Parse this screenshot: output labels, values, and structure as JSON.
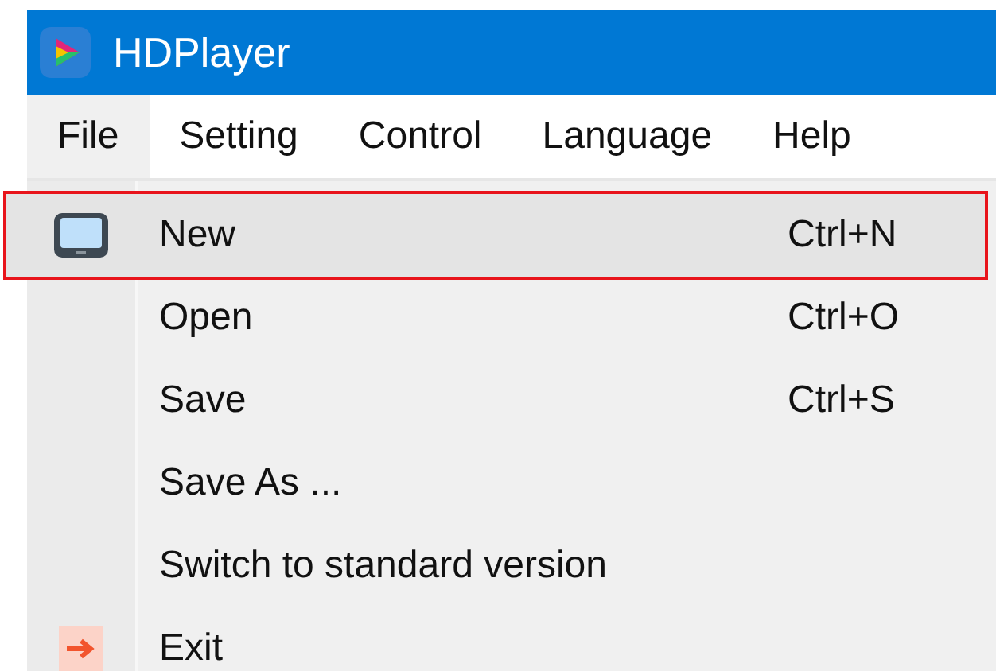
{
  "window": {
    "title": "HDPlayer"
  },
  "menu_bar": [
    {
      "label": "File",
      "selected": true
    },
    {
      "label": "Setting",
      "selected": false
    },
    {
      "label": "Control",
      "selected": false
    },
    {
      "label": "Language",
      "selected": false
    },
    {
      "label": "Help",
      "selected": false
    }
  ],
  "dropdown": [
    {
      "label": "New",
      "shortcut": "Ctrl+N",
      "kind": "monitor",
      "selected": true,
      "outlined": true
    },
    {
      "label": "Open",
      "shortcut": "Ctrl+O",
      "kind": "plain",
      "selected": false,
      "outlined": false
    },
    {
      "label": "Save",
      "shortcut": "Ctrl+S",
      "kind": "plain",
      "selected": false,
      "outlined": false
    },
    {
      "label": "Save As ...",
      "kind": "plain",
      "selected": false,
      "outlined": false
    },
    {
      "label": "Switch to standard version",
      "kind": "plain",
      "selected": false,
      "outlined": false
    },
    {
      "label": "Exit",
      "kind": "exit",
      "selected": false,
      "outlined": false
    }
  ]
}
